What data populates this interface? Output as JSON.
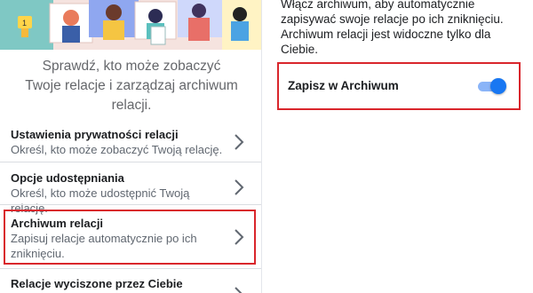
{
  "left": {
    "intro": "Sprawdź, kto może zobaczyć Twoje relacje i zarządzaj archiwum relacji.",
    "items": [
      {
        "title": "Ustawienia prywatności relacji",
        "desc": "Określ, kto może zobaczyć Twoją relację."
      },
      {
        "title": "Opcje udostępniania",
        "desc": "Określ, kto może udostępnić Twoją relację."
      },
      {
        "title": "Archiwum relacji",
        "desc": "Zapisuj relacje automatycznie po ich zniknięciu."
      },
      {
        "title": "Relacje wyciszone przez Ciebie",
        "desc": ""
      }
    ],
    "badge": "1"
  },
  "right": {
    "description": "Włącz archiwum, aby automatycznie zapisywać swoje relacje po ich zniknięciu. Archiwum relacji jest widoczne tylko dla Ciebie.",
    "toggle_label": "Zapisz w Archiwum",
    "toggle_on": true
  },
  "colors": {
    "highlight": "#d9262c",
    "toggle_accent": "#1877f2",
    "secondary_text": "#606770"
  }
}
